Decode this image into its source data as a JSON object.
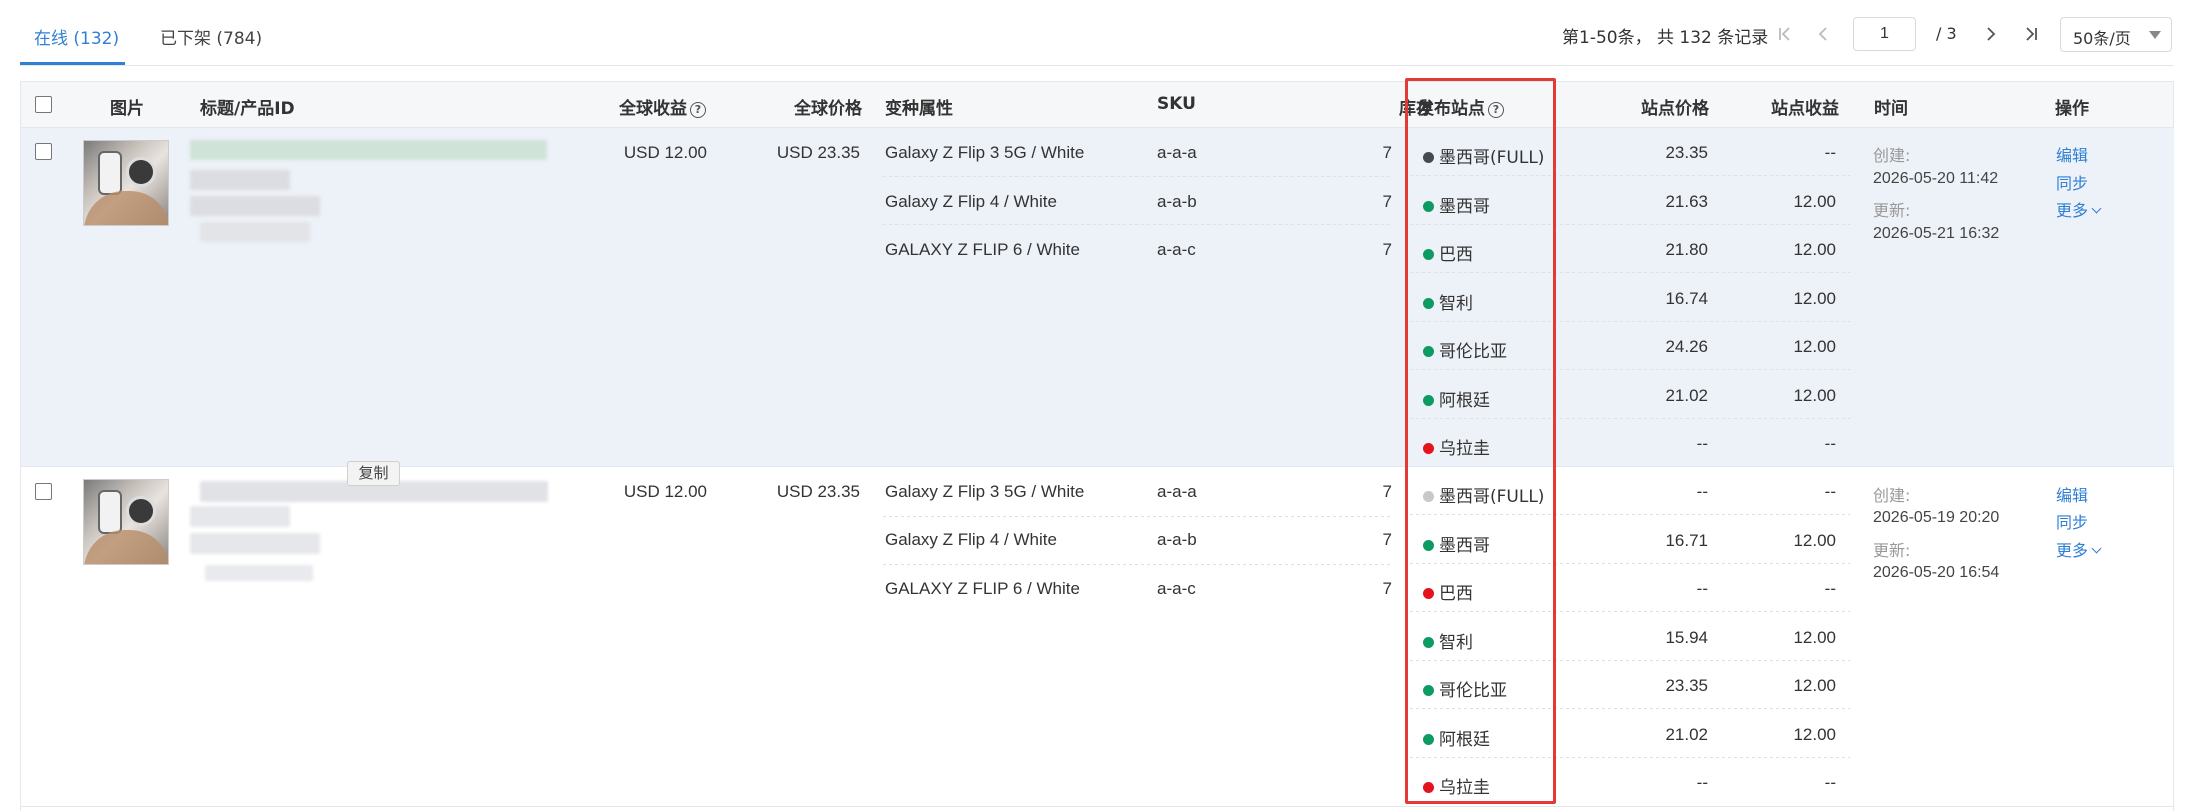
{
  "tabs": [
    {
      "label": "在线 (132)",
      "active": true
    },
    {
      "label": "已下架 (784)",
      "active": false
    }
  ],
  "pagination": {
    "range_text": "第1-50条，  共 132 条记录",
    "current_page": "1",
    "total_pages": "/ 3",
    "page_size": "50条/页"
  },
  "headers": {
    "image": "图片",
    "title": "标题/产品ID",
    "global_profit": "全球收益",
    "global_price": "全球价格",
    "variant": "变种属性",
    "sku": "SKU",
    "stock": "库存",
    "site": "发布站点",
    "site_price": "站点价格",
    "site_profit": "站点收益",
    "time": "时间",
    "action": "操作"
  },
  "colors": {
    "accent": "#2f7fd4",
    "status_dark": "#444a52",
    "status_green": "#0e9a63",
    "status_red": "#e3141e",
    "status_grey": "#c8c8c8",
    "highlight": "#e53935"
  },
  "rows": [
    {
      "global_profit": "USD 12.00",
      "global_price": "USD 23.35",
      "variants": [
        {
          "name": "Galaxy Z Flip 3 5G / White",
          "sku": "a-a-a",
          "stock": "7"
        },
        {
          "name": "Galaxy Z Flip 4 / White",
          "sku": "a-a-b",
          "stock": "7"
        },
        {
          "name": "GALAXY Z FLIP 6 / White",
          "sku": "a-a-c",
          "stock": "7"
        }
      ],
      "sites": [
        {
          "name": "墨西哥(FULL)",
          "status": "dark",
          "price": "23.35",
          "profit": "--"
        },
        {
          "name": "墨西哥",
          "status": "green",
          "price": "21.63",
          "profit": "12.00"
        },
        {
          "name": "巴西",
          "status": "green",
          "price": "21.80",
          "profit": "12.00"
        },
        {
          "name": "智利",
          "status": "green",
          "price": "16.74",
          "profit": "12.00"
        },
        {
          "name": "哥伦比亚",
          "status": "green",
          "price": "24.26",
          "profit": "12.00"
        },
        {
          "name": "阿根廷",
          "status": "green",
          "price": "21.02",
          "profit": "12.00"
        },
        {
          "name": "乌拉圭",
          "status": "red",
          "price": "--",
          "profit": "--"
        }
      ],
      "created_label": "创建:",
      "created": "2026-05-20 11:42",
      "updated_label": "更新:",
      "updated": "2026-05-21 16:32",
      "actions": {
        "edit": "编辑",
        "sync": "同步",
        "more": "更多"
      }
    },
    {
      "global_profit": "USD 12.00",
      "global_price": "USD 23.35",
      "variants": [
        {
          "name": "Galaxy Z Flip 3 5G / White",
          "sku": "a-a-a",
          "stock": "7"
        },
        {
          "name": "Galaxy Z Flip 4 / White",
          "sku": "a-a-b",
          "stock": "7"
        },
        {
          "name": "GALAXY Z FLIP 6 / White",
          "sku": "a-a-c",
          "stock": "7"
        }
      ],
      "sites": [
        {
          "name": "墨西哥(FULL)",
          "status": "grey",
          "price": "--",
          "profit": "--"
        },
        {
          "name": "墨西哥",
          "status": "green",
          "price": "16.71",
          "profit": "12.00"
        },
        {
          "name": "巴西",
          "status": "red",
          "price": "--",
          "profit": "--"
        },
        {
          "name": "智利",
          "status": "green",
          "price": "15.94",
          "profit": "12.00"
        },
        {
          "name": "哥伦比亚",
          "status": "green",
          "price": "23.35",
          "profit": "12.00"
        },
        {
          "name": "阿根廷",
          "status": "green",
          "price": "21.02",
          "profit": "12.00"
        },
        {
          "name": "乌拉圭",
          "status": "red",
          "price": "--",
          "profit": "--"
        }
      ],
      "created_label": "创建:",
      "created": "2026-05-19 20:20",
      "updated_label": "更新:",
      "updated": "2026-05-20 16:54",
      "actions": {
        "edit": "编辑",
        "sync": "同步",
        "more": "更多"
      }
    }
  ],
  "copy_tooltip": "复制"
}
